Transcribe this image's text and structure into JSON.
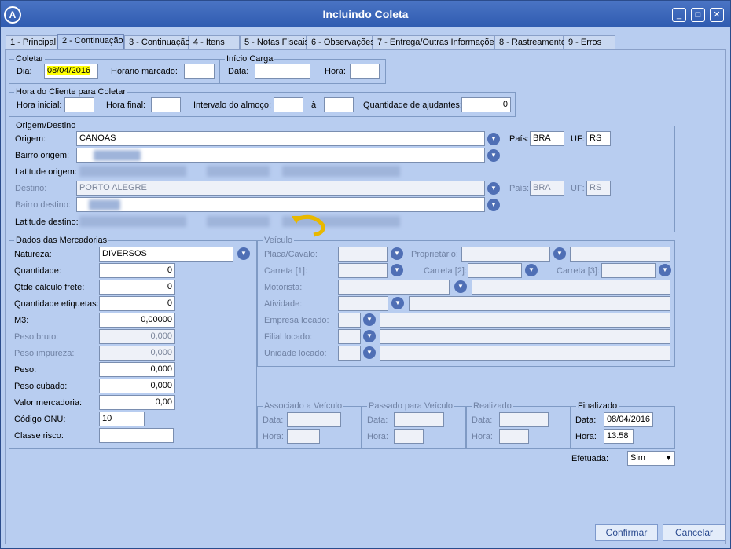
{
  "window": {
    "title": "Incluindo Coleta",
    "logo": "A",
    "controls": {
      "minimize": "_",
      "maximize": "□",
      "close": "✕"
    }
  },
  "tabs": [
    "1 - Principal",
    "2 - Continuação",
    "3 - Continuação",
    "4 - Itens",
    "5 - Notas Fiscais",
    "6 - Observações",
    "7 - Entrega/Outras Informações",
    "8 - Rastreamento",
    "9 - Erros"
  ],
  "active_tab_index": 1,
  "coletar": {
    "legend": "Coletar",
    "dia_label": "Dia:",
    "dia_value": "08/04/2016",
    "horario_label": "Horário marcado:",
    "horario_value": ""
  },
  "inicio_carga": {
    "legend": "Início Carga",
    "data_label": "Data:",
    "data_value": "",
    "hora_label": "Hora:",
    "hora_value": ""
  },
  "hora_cliente": {
    "legend": "Hora do Cliente para Coletar",
    "hora_inicial_label": "Hora inicial:",
    "hora_final_label": "Hora final:",
    "intervalo_label": "Intervalo do almoço:",
    "a_label": "à",
    "ajudantes_label": "Quantidade de ajudantes:",
    "ajudantes_value": "0"
  },
  "origem_destino": {
    "legend": "Origem/Destino",
    "origem_label": "Origem:",
    "origem_value": "CANOAS",
    "pais_label": "País:",
    "pais_origem": "BRA",
    "uf_label": "UF:",
    "uf_origem": "RS",
    "bairro_origem_label": "Bairro origem:",
    "latitude_origem_label": "Latitude origem:",
    "destino_label": "Destino:",
    "destino_value": "PORTO ALEGRE",
    "pais_destino": "BRA",
    "uf_destino": "RS",
    "bairro_destino_label": "Bairro destino:",
    "latitude_destino_label": "Latitude destino:"
  },
  "mercadorias": {
    "legend": "Dados das Mercadorias",
    "natureza_label": "Natureza:",
    "natureza_value": "DIVERSOS",
    "quantidade_label": "Quantidade:",
    "quantidade_value": "0",
    "qtde_frete_label": "Qtde cálculo frete:",
    "qtde_frete_value": "0",
    "qtde_etiquetas_label": "Quantidade etiquetas:",
    "qtde_etiquetas_value": "0",
    "m3_label": "M3:",
    "m3_value": "0,00000",
    "peso_bruto_label": "Peso bruto:",
    "peso_bruto_value": "0,000",
    "peso_impureza_label": "Peso impureza:",
    "peso_impureza_value": "0,000",
    "peso_label": "Peso:",
    "peso_value": "0,000",
    "peso_cubado_label": "Peso cubado:",
    "peso_cubado_value": "0,000",
    "valor_label": "Valor mercadoria:",
    "valor_value": "0,00",
    "onu_label": "Código ONU:",
    "onu_value": "10",
    "classe_label": "Classe risco:",
    "classe_value": ""
  },
  "veiculo": {
    "legend": "Veículo",
    "placa_label": "Placa/Cavalo:",
    "proprietario_label": "Proprietário:",
    "carreta1_label": "Carreta [1]:",
    "carreta2_label": "Carreta [2]:",
    "carreta3_label": "Carreta [3]:",
    "motorista_label": "Motorista:",
    "atividade_label": "Atividade:",
    "empresa_label": "Empresa locado:",
    "filial_label": "Filial locado:",
    "unidade_label": "Unidade locado:"
  },
  "associado": {
    "legend": "Associado a Veículo",
    "data_label": "Data:",
    "hora_label": "Hora:"
  },
  "passado": {
    "legend": "Passado para Veículo",
    "data_label": "Data:",
    "hora_label": "Hora:"
  },
  "realizado": {
    "legend": "Realizado",
    "data_label": "Data:",
    "hora_label": "Hora:"
  },
  "finalizado": {
    "legend": "Finalizado",
    "data_label": "Data:",
    "data_value": "08/04/2016",
    "hora_label": "Hora:",
    "hora_value": "13:58"
  },
  "efetuada": {
    "label": "Efetuada:",
    "value": "Sim"
  },
  "buttons": {
    "confirmar": "Confirmar",
    "cancelar": "Cancelar"
  },
  "icons": {
    "combo": "chevron-down-icon",
    "select": "▼"
  },
  "colors": {
    "titlebar": "#2f5bb0",
    "panel": "#b8cdf0",
    "highlight": "#ffff00"
  }
}
